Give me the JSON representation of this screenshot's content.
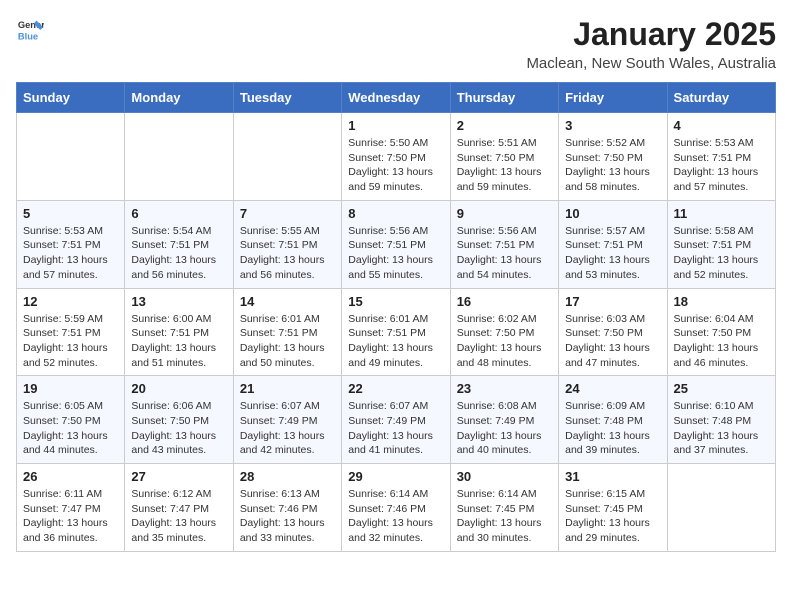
{
  "header": {
    "logo_line1": "General",
    "logo_line2": "Blue",
    "month": "January 2025",
    "location": "Maclean, New South Wales, Australia"
  },
  "weekdays": [
    "Sunday",
    "Monday",
    "Tuesday",
    "Wednesday",
    "Thursday",
    "Friday",
    "Saturday"
  ],
  "weeks": [
    [
      {
        "day": "",
        "info": ""
      },
      {
        "day": "",
        "info": ""
      },
      {
        "day": "",
        "info": ""
      },
      {
        "day": "1",
        "info": "Sunrise: 5:50 AM\nSunset: 7:50 PM\nDaylight: 13 hours\nand 59 minutes."
      },
      {
        "day": "2",
        "info": "Sunrise: 5:51 AM\nSunset: 7:50 PM\nDaylight: 13 hours\nand 59 minutes."
      },
      {
        "day": "3",
        "info": "Sunrise: 5:52 AM\nSunset: 7:50 PM\nDaylight: 13 hours\nand 58 minutes."
      },
      {
        "day": "4",
        "info": "Sunrise: 5:53 AM\nSunset: 7:51 PM\nDaylight: 13 hours\nand 57 minutes."
      }
    ],
    [
      {
        "day": "5",
        "info": "Sunrise: 5:53 AM\nSunset: 7:51 PM\nDaylight: 13 hours\nand 57 minutes."
      },
      {
        "day": "6",
        "info": "Sunrise: 5:54 AM\nSunset: 7:51 PM\nDaylight: 13 hours\nand 56 minutes."
      },
      {
        "day": "7",
        "info": "Sunrise: 5:55 AM\nSunset: 7:51 PM\nDaylight: 13 hours\nand 56 minutes."
      },
      {
        "day": "8",
        "info": "Sunrise: 5:56 AM\nSunset: 7:51 PM\nDaylight: 13 hours\nand 55 minutes."
      },
      {
        "day": "9",
        "info": "Sunrise: 5:56 AM\nSunset: 7:51 PM\nDaylight: 13 hours\nand 54 minutes."
      },
      {
        "day": "10",
        "info": "Sunrise: 5:57 AM\nSunset: 7:51 PM\nDaylight: 13 hours\nand 53 minutes."
      },
      {
        "day": "11",
        "info": "Sunrise: 5:58 AM\nSunset: 7:51 PM\nDaylight: 13 hours\nand 52 minutes."
      }
    ],
    [
      {
        "day": "12",
        "info": "Sunrise: 5:59 AM\nSunset: 7:51 PM\nDaylight: 13 hours\nand 52 minutes."
      },
      {
        "day": "13",
        "info": "Sunrise: 6:00 AM\nSunset: 7:51 PM\nDaylight: 13 hours\nand 51 minutes."
      },
      {
        "day": "14",
        "info": "Sunrise: 6:01 AM\nSunset: 7:51 PM\nDaylight: 13 hours\nand 50 minutes."
      },
      {
        "day": "15",
        "info": "Sunrise: 6:01 AM\nSunset: 7:51 PM\nDaylight: 13 hours\nand 49 minutes."
      },
      {
        "day": "16",
        "info": "Sunrise: 6:02 AM\nSunset: 7:50 PM\nDaylight: 13 hours\nand 48 minutes."
      },
      {
        "day": "17",
        "info": "Sunrise: 6:03 AM\nSunset: 7:50 PM\nDaylight: 13 hours\nand 47 minutes."
      },
      {
        "day": "18",
        "info": "Sunrise: 6:04 AM\nSunset: 7:50 PM\nDaylight: 13 hours\nand 46 minutes."
      }
    ],
    [
      {
        "day": "19",
        "info": "Sunrise: 6:05 AM\nSunset: 7:50 PM\nDaylight: 13 hours\nand 44 minutes."
      },
      {
        "day": "20",
        "info": "Sunrise: 6:06 AM\nSunset: 7:50 PM\nDaylight: 13 hours\nand 43 minutes."
      },
      {
        "day": "21",
        "info": "Sunrise: 6:07 AM\nSunset: 7:49 PM\nDaylight: 13 hours\nand 42 minutes."
      },
      {
        "day": "22",
        "info": "Sunrise: 6:07 AM\nSunset: 7:49 PM\nDaylight: 13 hours\nand 41 minutes."
      },
      {
        "day": "23",
        "info": "Sunrise: 6:08 AM\nSunset: 7:49 PM\nDaylight: 13 hours\nand 40 minutes."
      },
      {
        "day": "24",
        "info": "Sunrise: 6:09 AM\nSunset: 7:48 PM\nDaylight: 13 hours\nand 39 minutes."
      },
      {
        "day": "25",
        "info": "Sunrise: 6:10 AM\nSunset: 7:48 PM\nDaylight: 13 hours\nand 37 minutes."
      }
    ],
    [
      {
        "day": "26",
        "info": "Sunrise: 6:11 AM\nSunset: 7:47 PM\nDaylight: 13 hours\nand 36 minutes."
      },
      {
        "day": "27",
        "info": "Sunrise: 6:12 AM\nSunset: 7:47 PM\nDaylight: 13 hours\nand 35 minutes."
      },
      {
        "day": "28",
        "info": "Sunrise: 6:13 AM\nSunset: 7:46 PM\nDaylight: 13 hours\nand 33 minutes."
      },
      {
        "day": "29",
        "info": "Sunrise: 6:14 AM\nSunset: 7:46 PM\nDaylight: 13 hours\nand 32 minutes."
      },
      {
        "day": "30",
        "info": "Sunrise: 6:14 AM\nSunset: 7:45 PM\nDaylight: 13 hours\nand 30 minutes."
      },
      {
        "day": "31",
        "info": "Sunrise: 6:15 AM\nSunset: 7:45 PM\nDaylight: 13 hours\nand 29 minutes."
      },
      {
        "day": "",
        "info": ""
      }
    ]
  ]
}
